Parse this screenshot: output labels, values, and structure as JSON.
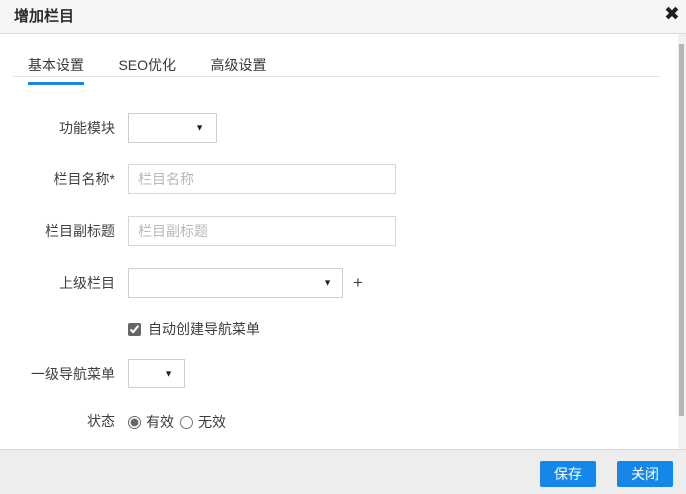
{
  "modal": {
    "title": "增加栏目",
    "close_icon": "✖"
  },
  "tabs": [
    {
      "label": "基本设置",
      "active": true
    },
    {
      "label": "SEO优化",
      "active": false
    },
    {
      "label": "高级设置",
      "active": false
    }
  ],
  "form": {
    "module": {
      "label": "功能模块",
      "value": ""
    },
    "name": {
      "label": "栏目名称*",
      "value": "",
      "placeholder": "栏目名称"
    },
    "subtitle": {
      "label": "栏目副标题",
      "value": "",
      "placeholder": "栏目副标题"
    },
    "parent": {
      "label": "上级栏目",
      "value": "",
      "add_label": "+"
    },
    "auto_nav": {
      "label": "自动创建导航菜单",
      "checked": "true"
    },
    "nav": {
      "label": "一级导航菜单",
      "value": ""
    },
    "status": {
      "label": "状态",
      "valid_label": "有效",
      "invalid_label": "无效",
      "selected": "有效"
    }
  },
  "icons": {
    "dropdown_arrow": "▼"
  },
  "footer": {
    "save_label": "保存",
    "close_label": "关闭"
  },
  "colors": {
    "accent_blue": "#1a86e8",
    "button_blue": "#1487e9",
    "header_bg": "#f5f5f5",
    "footer_bg": "#ededed"
  }
}
